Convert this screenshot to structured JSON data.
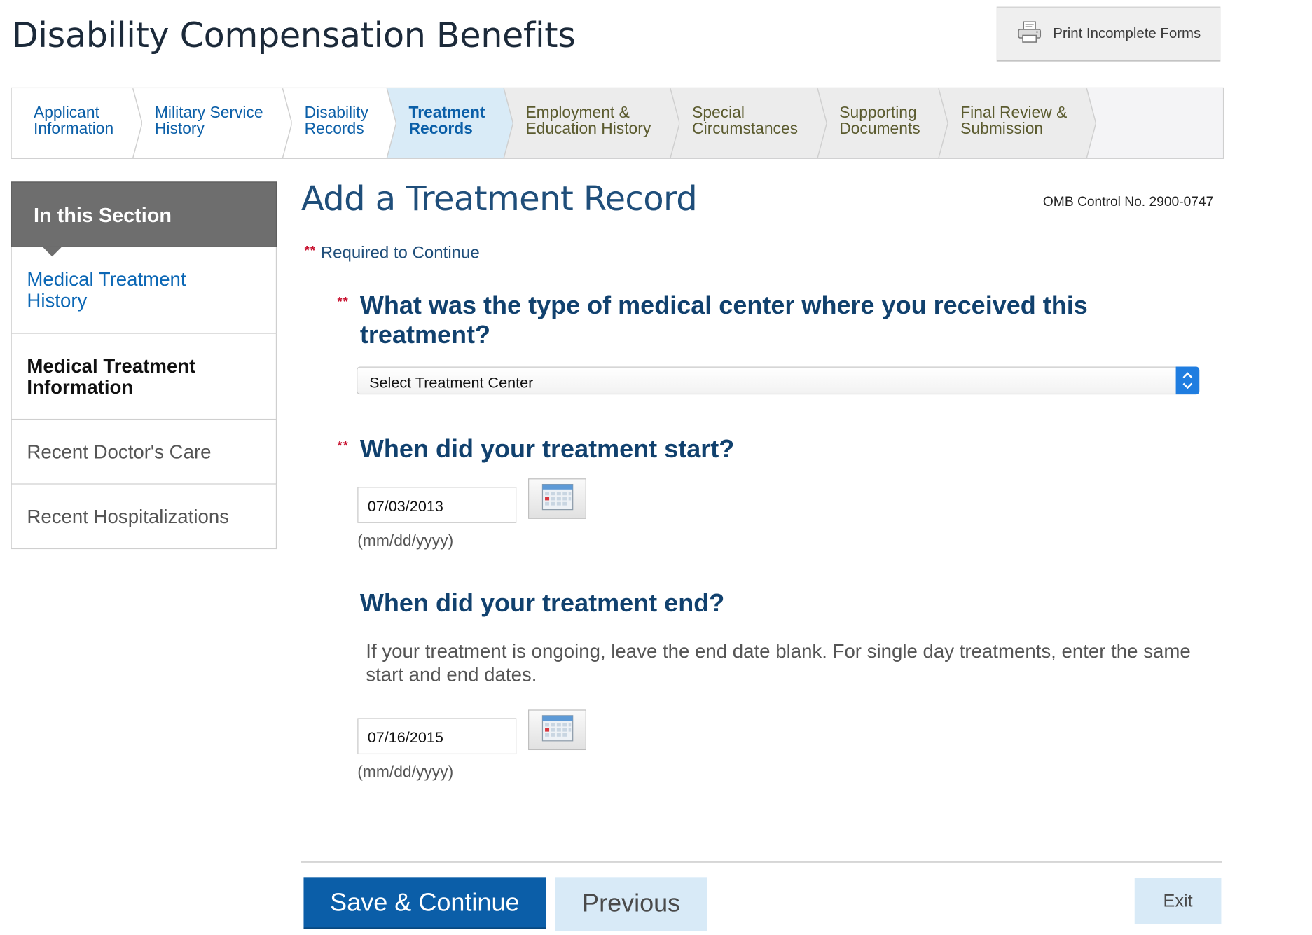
{
  "header": {
    "title": "Disability Compensation Benefits",
    "print_label": "Print Incomplete Forms"
  },
  "steps": [
    {
      "line1": "Applicant",
      "line2": "Information",
      "state": "done"
    },
    {
      "line1": "Military Service",
      "line2": "History",
      "state": "done"
    },
    {
      "line1": "Disability",
      "line2": "Records",
      "state": "done"
    },
    {
      "line1": "Treatment",
      "line2": "Records",
      "state": "current"
    },
    {
      "line1": "Employment &",
      "line2": "Education History",
      "state": "todo"
    },
    {
      "line1": "Special",
      "line2": "Circumstances",
      "state": "todo"
    },
    {
      "line1": "Supporting",
      "line2": "Documents",
      "state": "todo"
    },
    {
      "line1": "Final Review &",
      "line2": "Submission",
      "state": "todo"
    }
  ],
  "sidebar": {
    "heading": "In this Section",
    "items": [
      {
        "label": "Medical Treatment History",
        "state": "link"
      },
      {
        "label": "Medical Treatment Information",
        "state": "active"
      },
      {
        "label": "Recent Doctor's Care",
        "state": "plain"
      },
      {
        "label": "Recent Hospitalizations",
        "state": "plain"
      }
    ]
  },
  "main": {
    "title": "Add a Treatment Record",
    "omb": "OMB Control No. 2900-0747",
    "required_marker": "**",
    "required_text": "Required to Continue",
    "q_center": {
      "label": "What was the type of medical center where you received this treatment?",
      "select_value": "Select Treatment Center"
    },
    "q_start": {
      "label": "When did your treatment start?",
      "value": "07/03/2013",
      "format_hint": "(mm/dd/yyyy)"
    },
    "q_end": {
      "label": "When did your treatment end?",
      "help": "If your treatment is ongoing, leave the end date blank. For single day treatments, enter the same start and end dates.",
      "value": "07/16/2015",
      "format_hint": "(mm/dd/yyyy)"
    }
  },
  "footer": {
    "save_label": "Save & Continue",
    "previous_label": "Previous",
    "exit_label": "Exit"
  },
  "icons": {
    "print": "printer-icon",
    "calendar": "calendar-icon",
    "select_arrows": "up-down-chevron-icon"
  },
  "colors": {
    "primary": "#0b5ea8",
    "heading": "#11416e",
    "current_step_bg": "#d9ebf7",
    "required": "#c8102e"
  }
}
